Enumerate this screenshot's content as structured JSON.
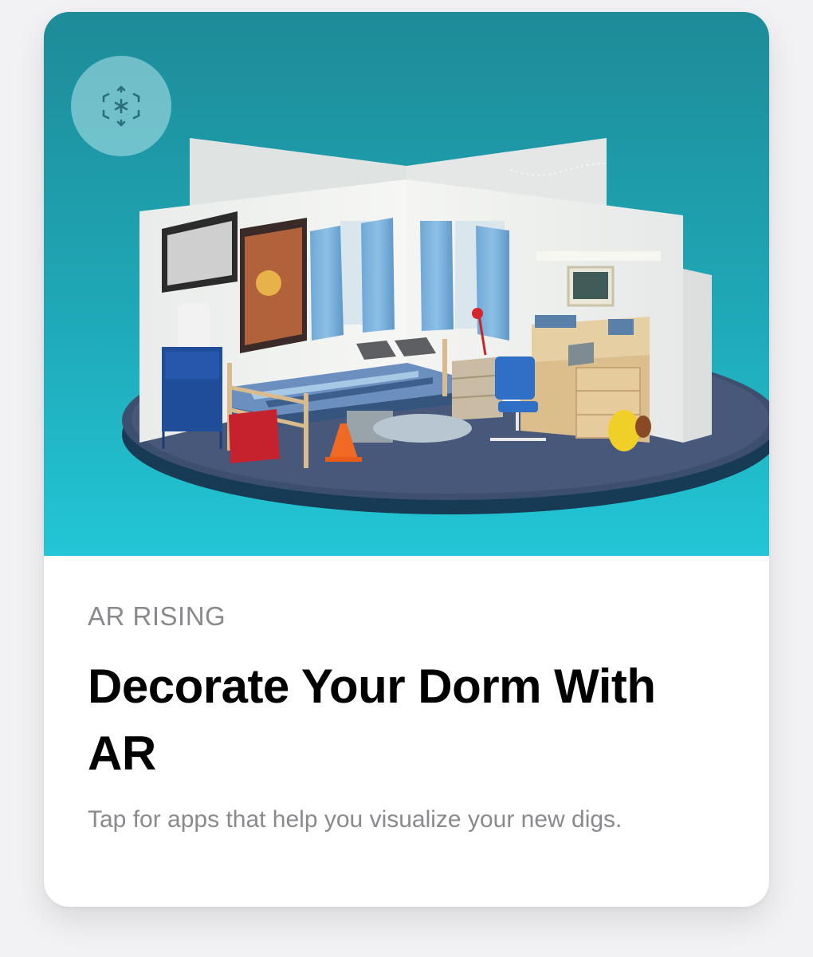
{
  "card": {
    "eyebrow": "AR RISING",
    "headline": "Decorate Your Dorm With AR",
    "subtitle": "Tap for apps that help you visualize your new digs.",
    "badge_icon": "ar-cube-icon",
    "hero_image": "illustration of a 3D dorm room on a round platform with bed, desk, chair, posters and blue curtains"
  },
  "colors": {
    "hero_top": "#1f8f9c",
    "hero_bottom": "#21c3d3",
    "eyebrow": "#8a8a8e",
    "headline": "#000000",
    "subtitle": "#8a8a8e",
    "background": "#f2f2f4"
  }
}
